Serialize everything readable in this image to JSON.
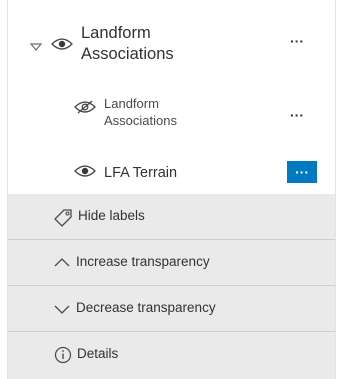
{
  "layers": {
    "group": {
      "title_line1": "Landform",
      "title_line2": "Associations",
      "more_label": "···"
    },
    "child_hidden": {
      "title_line1": "Landform",
      "title_line2": "Associations",
      "more_label": "···"
    },
    "child_visible": {
      "title": "LFA Terrain",
      "more_label": "···"
    }
  },
  "menu": {
    "items": [
      {
        "label": "Hide labels",
        "icon": "tag-icon"
      },
      {
        "label": "Increase transparency",
        "icon": "chevron-up-icon"
      },
      {
        "label": "Decrease transparency",
        "icon": "chevron-down-icon"
      },
      {
        "label": "Details",
        "icon": "info-icon"
      }
    ]
  },
  "colors": {
    "accent": "#0079c1",
    "menu_background": "#eaeaea"
  }
}
